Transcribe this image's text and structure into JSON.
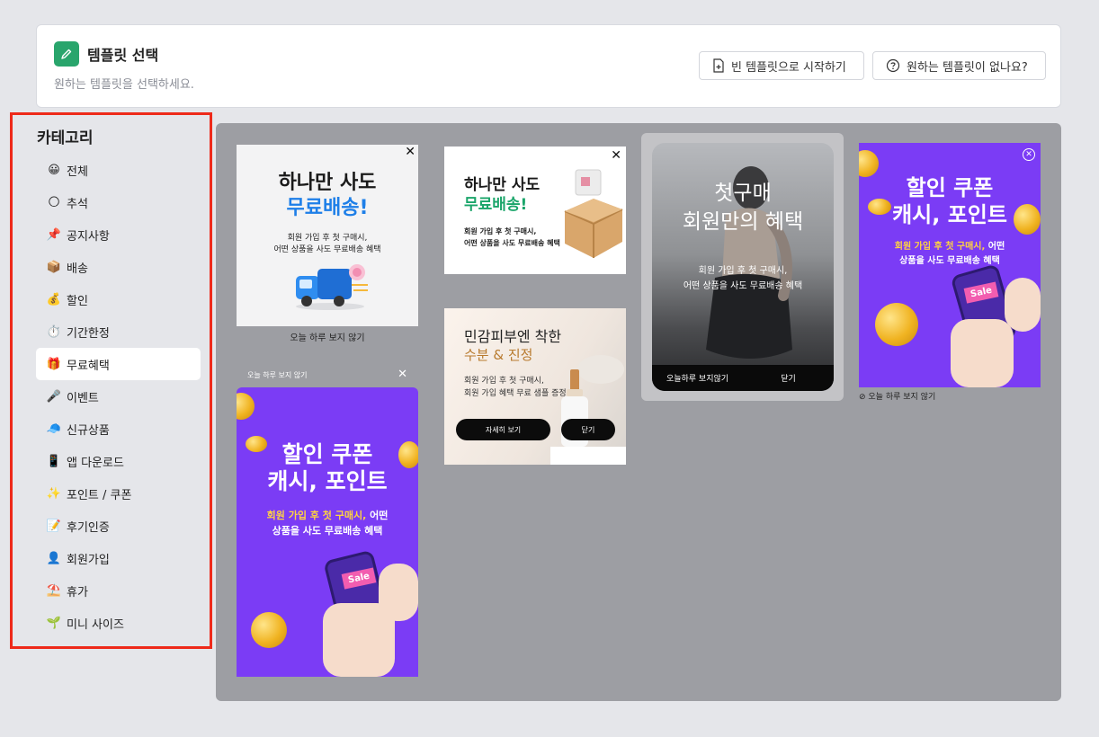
{
  "header": {
    "title": "템플릿 선택",
    "subtitle": "원하는 템플릿을 선택하세요.",
    "buttons": {
      "blank": "빈 템플릿으로 시작하기",
      "request": "원하는 템플릿이 없나요?"
    },
    "accent_color": "#29a56c"
  },
  "sidebar": {
    "title": "카테고리",
    "items": [
      {
        "emoji": "😀",
        "label": "전체"
      },
      {
        "emoji": "🌕",
        "label": "추석"
      },
      {
        "emoji": "📌",
        "label": "공지사항"
      },
      {
        "emoji": "📦",
        "label": "배송"
      },
      {
        "emoji": "💰",
        "label": "할인"
      },
      {
        "emoji": "⏱️",
        "label": "기간한정"
      },
      {
        "emoji": "🎁",
        "label": "무료혜택"
      },
      {
        "emoji": "🎤",
        "label": "이벤트"
      },
      {
        "emoji": "🧢",
        "label": "신규상품"
      },
      {
        "emoji": "📱",
        "label": "앱 다운로드"
      },
      {
        "emoji": "✨",
        "label": "포인트 / 쿠폰"
      },
      {
        "emoji": "📝",
        "label": "후기인증"
      },
      {
        "emoji": "👤",
        "label": "회원가입"
      },
      {
        "emoji": "⛱️",
        "label": "휴가"
      },
      {
        "emoji": "🌱",
        "label": "미니 사이즈"
      }
    ],
    "active_index": 6
  },
  "templates": {
    "shipping1": {
      "title1": "하나만 사도",
      "title2": "무료배송!",
      "body1": "회원 가입 후 첫 구매시,",
      "body2": "어떤 상품을 사도 무료배송 혜택",
      "caption": "오늘 하루 보지 않기"
    },
    "shipping2": {
      "title1": "하나만 사도",
      "title2": "무료배송!",
      "body1": "회원 가입 후 첫 구매시,",
      "body2": "어떤 상품을 사도 무료배송 혜택"
    },
    "sample": {
      "title1": "민감피부엔 착한",
      "title2": "수분 & 진정",
      "body1": "회원 가입 후 첫 구매시,",
      "body2": "회원 가입 혜택 무료 샘플 증정",
      "btn_detail": "자세히 보기",
      "btn_close": "닫기"
    },
    "member": {
      "title1": "첫구매",
      "title2": "회원만의 혜택",
      "body1": "회원 가입 후 첫 구매시,",
      "body2": "어떤 상품을 사도 무료배송 혜택",
      "bar_left": "오늘하루 보지않기",
      "bar_right": "닫기"
    },
    "coupon1": {
      "title1": "할인 쿠폰",
      "title2": "캐시, 포인트",
      "body_hl": "회원 가입 후 첫 구매시,",
      "body_rest": " 어떤",
      "body2": "상품을 사도 무료배송 혜택",
      "sale": "Sale",
      "caption": "⊘ 오늘 하루 보지 않기"
    },
    "coupon2": {
      "top_caption": "오늘 하루 보지 않기",
      "title1": "할인 쿠폰",
      "title2": "캐시, 포인트",
      "body_hl": "회원 가입 후 첫 구매시,",
      "body_rest": " 어떤",
      "body2": "상품을 사도 무료배송 혜택",
      "sale": "Sale"
    }
  }
}
